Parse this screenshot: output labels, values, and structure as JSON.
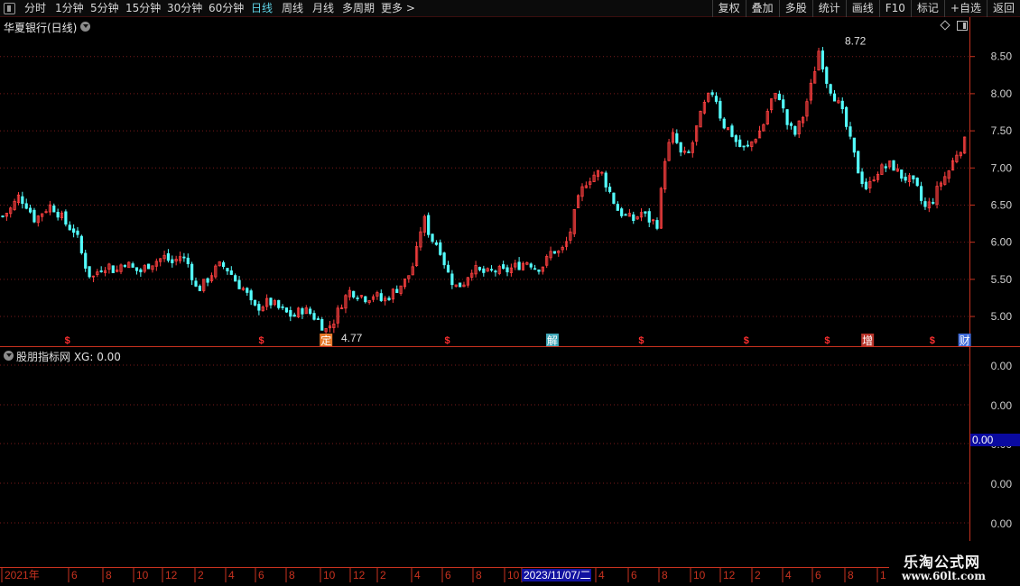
{
  "toolbar": {
    "periods": [
      "分时",
      "1分钟",
      "5分钟",
      "15分钟",
      "30分钟",
      "60分钟",
      "日线",
      "周线",
      "月线",
      "多周期",
      "更多 >"
    ],
    "active_period": "日线",
    "right_buttons": [
      "复权",
      "叠加",
      "多股",
      "统计",
      "画线",
      "F10",
      "标记",
      "+自选",
      "返回"
    ]
  },
  "main_panel": {
    "title": "华夏银行(日线)"
  },
  "indicator_panel": {
    "title": "股朋指标网 XG: 0.00",
    "axis_labels": [
      "0.00",
      "0.00",
      "0.00",
      "0.00",
      "0.00"
    ],
    "current_value": "0.00"
  },
  "date_axis": {
    "labels": [
      "2021年",
      "6",
      "8",
      "10",
      "12",
      "2",
      "4",
      "6",
      "8",
      "10",
      "12",
      "2",
      "4",
      "6",
      "8",
      "10",
      "2023/11/07/二",
      "4",
      "6",
      "8",
      "10",
      "12",
      "2",
      "4",
      "6",
      "8",
      "1"
    ]
  },
  "logo": {
    "line1": "乐淘公式网",
    "line2": "www.60lt.com"
  },
  "colors": {
    "up": "#ff4040",
    "down": "#54ffff",
    "grid": "#7a1a1a",
    "axis": "#c8321f"
  },
  "chart_data": {
    "type": "candlestick",
    "title": "华夏银行(日线)",
    "y_axis_ticks": [
      5.0,
      5.5,
      6.0,
      6.5,
      7.0,
      7.5,
      8.0,
      8.5
    ],
    "ylim": [
      4.6,
      8.8
    ],
    "high_label": "8.72",
    "low_label": "4.77",
    "price_path": [
      6.35,
      6.45,
      6.62,
      6.5,
      6.3,
      6.42,
      6.5,
      6.38,
      6.22,
      6.15,
      5.75,
      5.5,
      5.65,
      5.7,
      5.6,
      5.75,
      5.65,
      5.6,
      5.7,
      5.75,
      5.8,
      5.72,
      5.82,
      5.7,
      5.35,
      5.45,
      5.6,
      5.7,
      5.62,
      5.45,
      5.35,
      5.1,
      5.15,
      5.2,
      5.12,
      5.05,
      5.0,
      5.1,
      5.05,
      4.95,
      4.82,
      4.95,
      5.2,
      5.35,
      5.3,
      5.25,
      5.3,
      5.2,
      5.3,
      5.4,
      5.5,
      5.75,
      6.35,
      6.05,
      5.95,
      5.6,
      5.4,
      5.45,
      5.65,
      5.6,
      5.58,
      5.62,
      5.6,
      5.65,
      5.7,
      5.75,
      5.65,
      5.7,
      5.9,
      5.85,
      6.05,
      6.5,
      6.8,
      6.9,
      6.95,
      6.7,
      6.45,
      6.35,
      6.3,
      6.4,
      6.3,
      6.25,
      7.2,
      7.45,
      7.15,
      7.2,
      7.6,
      7.9,
      8.05,
      7.6,
      7.5,
      7.3,
      7.25,
      7.4,
      7.55,
      7.9,
      8.0,
      7.6,
      7.45,
      7.7,
      8.1,
      8.6,
      8.15,
      7.95,
      7.7,
      7.3,
      6.9,
      6.7,
      6.95,
      7.0,
      7.05,
      6.9,
      6.85,
      6.75,
      6.45,
      6.55,
      6.8,
      6.95,
      7.2,
      7.35
    ],
    "event_markers": [
      {
        "label": "$",
        "color": "#ff3030",
        "index": 8
      },
      {
        "label": "$",
        "color": "#ff3030",
        "index": 32
      },
      {
        "label": "定",
        "color": "#e8792a",
        "index": 40
      },
      {
        "label": "$",
        "color": "#ff3030",
        "index": 55
      },
      {
        "label": "解",
        "color": "#3fa7b8",
        "index": 68
      },
      {
        "label": "$",
        "color": "#ff3030",
        "index": 79
      },
      {
        "label": "$",
        "color": "#ff3030",
        "index": 92
      },
      {
        "label": "$",
        "color": "#ff3030",
        "index": 102
      },
      {
        "label": "增",
        "color": "#b8342a",
        "index": 107
      },
      {
        "label": "$",
        "color": "#ff3030",
        "index": 115
      },
      {
        "label": "财",
        "color": "#3f6ad8",
        "index": 119
      }
    ]
  }
}
